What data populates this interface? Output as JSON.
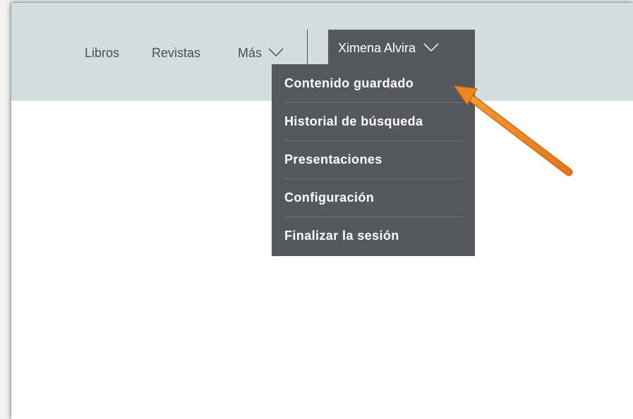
{
  "nav": {
    "items": [
      {
        "label": "Libros"
      },
      {
        "label": "Revistas"
      },
      {
        "label": "Más"
      }
    ]
  },
  "user": {
    "name": "Ximena Alvira"
  },
  "menu": {
    "items": [
      {
        "label": "Contenido guardado"
      },
      {
        "label": "Historial de búsqueda"
      },
      {
        "label": "Presentaciones"
      },
      {
        "label": "Configuración"
      },
      {
        "label": "Finalizar la sesión"
      }
    ]
  },
  "colors": {
    "header_bg": "#d2dde0",
    "menu_bg": "#55595e",
    "nav_text": "#4a4f55",
    "arrow": "#f0861e"
  },
  "icons": {
    "dropdown": "chevron-down-icon",
    "annotation": "annotation-arrow"
  }
}
